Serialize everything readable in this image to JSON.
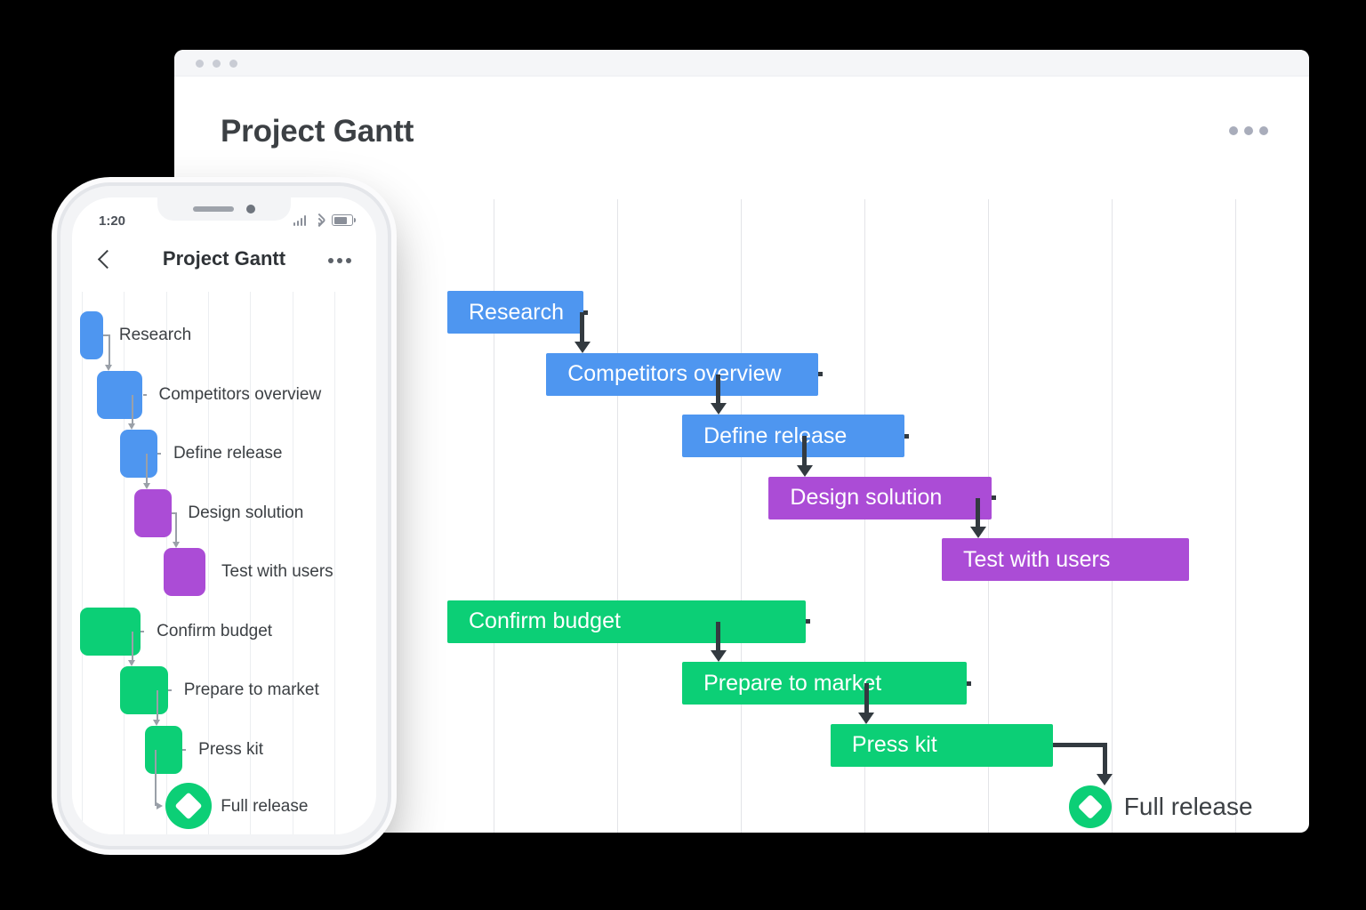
{
  "desktop": {
    "window_dots": [
      "dot-1",
      "dot-2",
      "dot-3"
    ],
    "title": "Project Gantt",
    "more_menu_label": "more-options"
  },
  "phone": {
    "time": "1:20",
    "title": "Project Gantt",
    "back_label": "back",
    "more_menu_label": "more-options",
    "status_icons": [
      "signal-icon",
      "wifi-icon",
      "battery-icon"
    ]
  },
  "colors": {
    "blue": "#4e96f0",
    "purple": "#ab4cd6",
    "green": "#0ccf76",
    "connector": "#333a40",
    "connector_phone": "#9aa0a8",
    "grid": "#e3e4e8",
    "text_dark": "#3c4044"
  },
  "chart_data": {
    "type": "table",
    "title": "Project Gantt",
    "xlabel": "",
    "ylabel": "",
    "grid": true,
    "legend": "none",
    "gridline_count": 7,
    "tasks": [
      {
        "label": "Research",
        "color": "#4e96f0",
        "kind": "bar",
        "start": 0.0,
        "end": 1.1,
        "row": 0
      },
      {
        "label": "Competitors overview",
        "color": "#4e96f0",
        "kind": "bar",
        "start": 0.8,
        "end": 3.0,
        "row": 1
      },
      {
        "label": "Define release",
        "color": "#4e96f0",
        "kind": "bar",
        "start": 1.9,
        "end": 3.7,
        "row": 2
      },
      {
        "label": "Design solution",
        "color": "#ab4cd6",
        "kind": "bar",
        "start": 2.6,
        "end": 4.4,
        "row": 3
      },
      {
        "label": "Test with users",
        "color": "#ab4cd6",
        "kind": "bar",
        "start": 4.0,
        "end": 6.0,
        "row": 4
      },
      {
        "label": "Confirm budget",
        "color": "#0ccf76",
        "kind": "bar",
        "start": 0.0,
        "end": 2.9,
        "row": 5
      },
      {
        "label": "Prepare to market",
        "color": "#0ccf76",
        "kind": "bar",
        "start": 1.9,
        "end": 4.2,
        "row": 6
      },
      {
        "label": "Press kit",
        "color": "#0ccf76",
        "kind": "bar",
        "start": 3.1,
        "end": 4.9,
        "row": 7
      },
      {
        "label": "Full release",
        "color": "#0ccf76",
        "kind": "milestone",
        "start": 5.2,
        "end": 5.2,
        "row": 8
      }
    ],
    "dependencies": [
      {
        "from": "Research",
        "to": "Competitors overview"
      },
      {
        "from": "Competitors overview",
        "to": "Define release"
      },
      {
        "from": "Define release",
        "to": "Design solution"
      },
      {
        "from": "Design solution",
        "to": "Test with users"
      },
      {
        "from": "Confirm budget",
        "to": "Prepare to market"
      },
      {
        "from": "Prepare to market",
        "to": "Press kit"
      },
      {
        "from": "Press kit",
        "to": "Full release"
      }
    ]
  }
}
